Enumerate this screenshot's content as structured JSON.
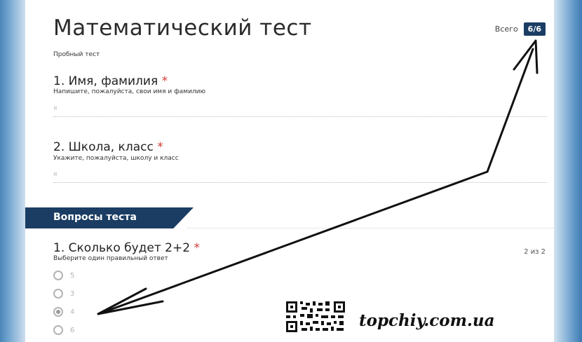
{
  "form": {
    "title": "Математический тест",
    "subtitle": "Пробный тест",
    "total_label": "Всего",
    "total_value": "6/6"
  },
  "questions_intro": [
    {
      "title": "1. Имя, фамилия",
      "required_mark": "*",
      "hint": "Напишите, пожалуйста, свои имя и фамилию",
      "answer": "я"
    },
    {
      "title": "2. Школа, класс",
      "required_mark": "*",
      "hint": "Укажите, пожалуйста, школу и класс",
      "answer": "я"
    }
  ],
  "section": {
    "label": "Вопросы теста"
  },
  "test_question": {
    "title": "1. Сколько будет 2+2",
    "required_mark": "*",
    "hint": "Выберите один правильный ответ",
    "score": "2 из 2",
    "options": [
      "5",
      "3",
      "4",
      "6"
    ],
    "selected_option": "4"
  },
  "watermark": {
    "text": "topchiy.com.ua"
  },
  "colors": {
    "accent": "#1b3d63",
    "required": "#d23c3c",
    "arrow": "#111111"
  },
  "icons": {
    "qr": "qr-code-icon",
    "arrow": "arrow-annotation"
  }
}
